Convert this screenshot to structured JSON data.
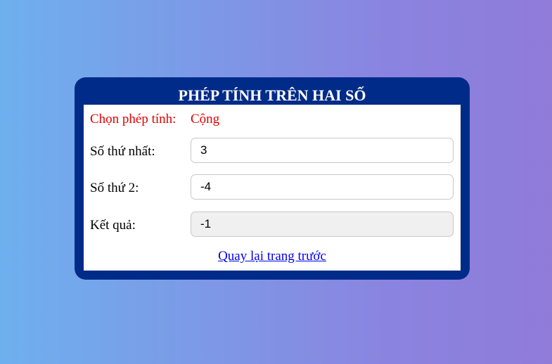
{
  "card": {
    "title": "PHÉP TÍNH TRÊN HAI SỐ"
  },
  "operation": {
    "label": "Chọn phép tính:",
    "value": "Cộng"
  },
  "fields": {
    "first": {
      "label": "Số thứ nhất:",
      "value": "3"
    },
    "second": {
      "label": "Số thứ 2:",
      "value": "-4"
    },
    "result": {
      "label": "Kết quả:",
      "value": "-1"
    }
  },
  "back_link": {
    "label": "Quay lại trang trước"
  },
  "colors": {
    "card_background": "#002b88",
    "operation_text": "#e00000",
    "link": "#0000ee"
  }
}
